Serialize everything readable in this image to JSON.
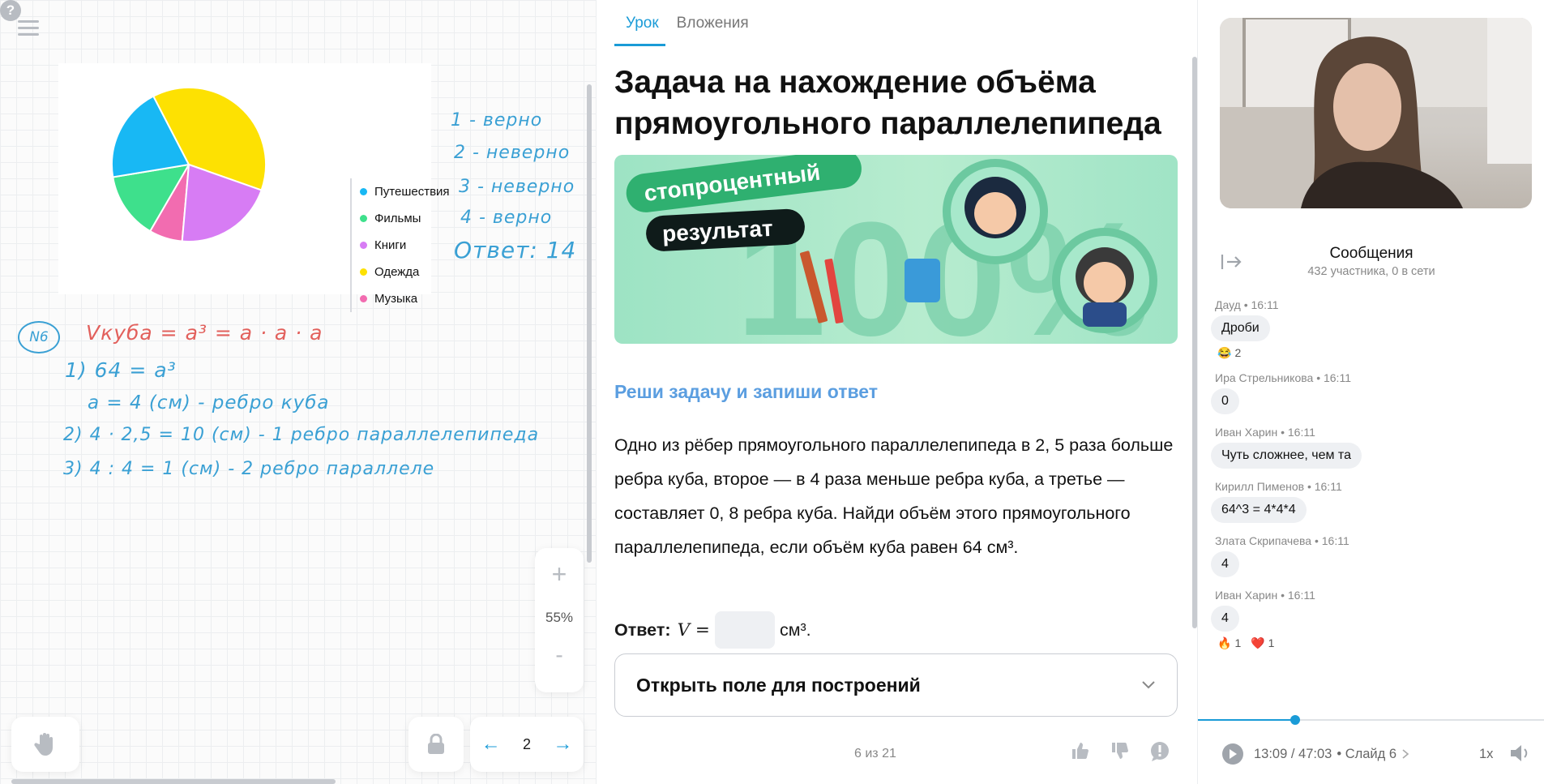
{
  "board": {
    "legend": [
      {
        "label": "Путешествия",
        "color": "#18b8f4"
      },
      {
        "label": "Фильмы",
        "color": "#3ee08c"
      },
      {
        "label": "Книги",
        "color": "#d77cf4"
      },
      {
        "label": "Одежда",
        "color": "#fde102"
      },
      {
        "label": "Музыка",
        "color": "#f26cb0"
      }
    ],
    "answers_note": [
      "1 - верно",
      "2 - неверно",
      "3 - неверно",
      "4 - верно",
      "Ответ: 14"
    ],
    "problem_label": "N6",
    "formula": "Vкуба = a³ = a · a · a",
    "steps": [
      "1) 64 = a³",
      "a = 4 (см) - ребро куба",
      "2) 4 · 2,5 = 10 (см) - 1 ребро параллелепипеда",
      "3) 4 : 4 = 1 (см) - 2 ребро параллеле"
    ],
    "zoom": {
      "plus": "+",
      "value": "55%",
      "minus": "-"
    },
    "pager": {
      "prev": "←",
      "page": "2",
      "next": "→"
    }
  },
  "lesson": {
    "tabs": [
      {
        "label": "Урок",
        "active": true
      },
      {
        "label": "Вложения",
        "active": false
      }
    ],
    "title": "Задача на нахождение объёма прямоугольного параллелепипеда",
    "banner": {
      "line1": "стопроцентный",
      "line2": "результат",
      "big": "100%"
    },
    "subhead": "Реши задачу и запиши ответ",
    "task": "Одно из рёбер прямоугольного параллелепипеда в 2, 5 раза больше ребра куба, второе — в 4 раза меньше ребра куба, а третье — составляет 0, 8 ребра куба. Найди объём этого прямоугольного параллелепипеда, если объём куба равен 64 см³.",
    "answer_label": "Ответ:",
    "answer_lhs": "V =",
    "answer_unit": "см³.",
    "construct_button": "Открыть поле для построений",
    "counter": "6 из 21"
  },
  "side": {
    "chat_title": "Сообщения",
    "chat_sub": "432 участника, 0 в сети",
    "messages": [
      {
        "meta": "Дауд • 16:11",
        "text": "Дроби",
        "reactions": [
          {
            "emoji": "😂",
            "count": "2"
          }
        ]
      },
      {
        "meta": "Ира Стрельникова • 16:11",
        "text": "0",
        "reactions": []
      },
      {
        "meta": "Иван Харин • 16:11",
        "text": "Чуть сложнее, чем та",
        "reactions": []
      },
      {
        "meta": "Кирилл Пименов • 16:11",
        "text": "64^3 = 4*4*4",
        "reactions": []
      },
      {
        "meta": "Злата Скрипачева • 16:11",
        "text": "4",
        "reactions": []
      },
      {
        "meta": "Иван Харин • 16:11",
        "text": "4",
        "reactions": [
          {
            "emoji": "🔥",
            "count": "1"
          },
          {
            "emoji": "❤️",
            "count": "1"
          }
        ]
      }
    ],
    "player": {
      "time": "13:09 / 47:03",
      "slide": "• Слайд 6",
      "speed": "1x",
      "progress": 0.28
    }
  },
  "chart_data": {
    "type": "pie",
    "categories": [
      "Путешествия",
      "Фильмы",
      "Книги",
      "Одежда",
      "Музыка"
    ],
    "values": [
      20,
      14,
      21,
      38,
      7
    ],
    "colors": [
      "#18b8f4",
      "#3ee08c",
      "#d77cf4",
      "#fde102",
      "#f26cb0"
    ],
    "legend": "right"
  }
}
